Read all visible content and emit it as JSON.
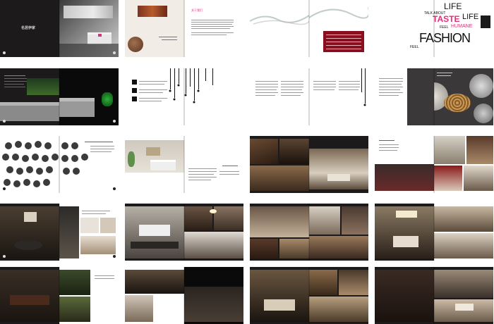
{
  "spreads": {
    "s1": {
      "logo": "名居伊家"
    },
    "s2": {
      "heading": "关于我们"
    },
    "s3": {},
    "s4": {
      "line1": "TALK ABOUT",
      "word1": "LIFE",
      "word2": "TASTE",
      "word3": "LIFE",
      "line3": "FEEL",
      "word4": "HUMANE",
      "line4": "FEEL",
      "word5": "FASHION"
    }
  },
  "colors": {
    "accent": "#e0307a",
    "dark": "#1c1a1a",
    "red_panel": "#8a0f1e"
  }
}
